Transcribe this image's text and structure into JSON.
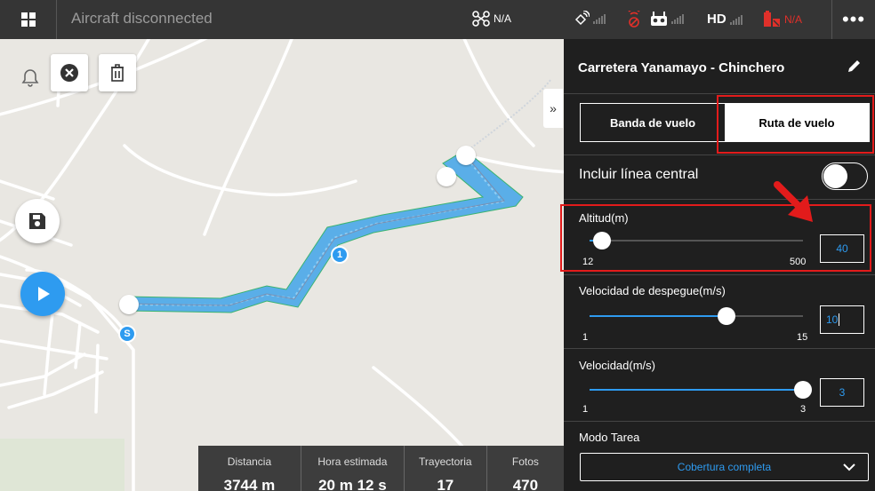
{
  "topbar": {
    "status_title": "Aircraft disconnected",
    "gps_label": "N/A",
    "hd_label": "HD",
    "battery_label": "N/A",
    "more_label": "•••"
  },
  "map": {
    "collapse_label": "»",
    "waypoint_label": "1",
    "start_label": "S"
  },
  "stats": [
    {
      "label": "Distancia",
      "value": "3744 m"
    },
    {
      "label": "Hora estimada",
      "value": "20 m 12 s"
    },
    {
      "label": "Trayectoria",
      "value": "17"
    },
    {
      "label": "Fotos",
      "value": "470"
    }
  ],
  "panel": {
    "mission_name": "Carretera Yanamayo - Chinchero",
    "tab_banda": "Banda de vuelo",
    "tab_ruta": "Ruta de vuelo",
    "include_centerline": "Incluir línea central",
    "include_centerline_on": false,
    "altitude": {
      "label": "Altitud(m)",
      "min": "12",
      "max": "500",
      "value": "40",
      "fraction": 0.06
    },
    "takeoff_speed": {
      "label": "Velocidad de despegue(m/s)",
      "min": "1",
      "max": "15",
      "value": "10",
      "fraction": 0.64
    },
    "speed": {
      "label": "Velocidad(m/s)",
      "min": "1",
      "max": "3",
      "value": "3",
      "fraction": 1.0
    },
    "task_mode": {
      "label": "Modo Tarea",
      "value": "Cobertura completa"
    }
  },
  "colors": {
    "accent": "#2e9bf0",
    "highlight": "#e21b1b",
    "panel_bg": "#1f1f1f",
    "topbar_bg": "#353535"
  }
}
